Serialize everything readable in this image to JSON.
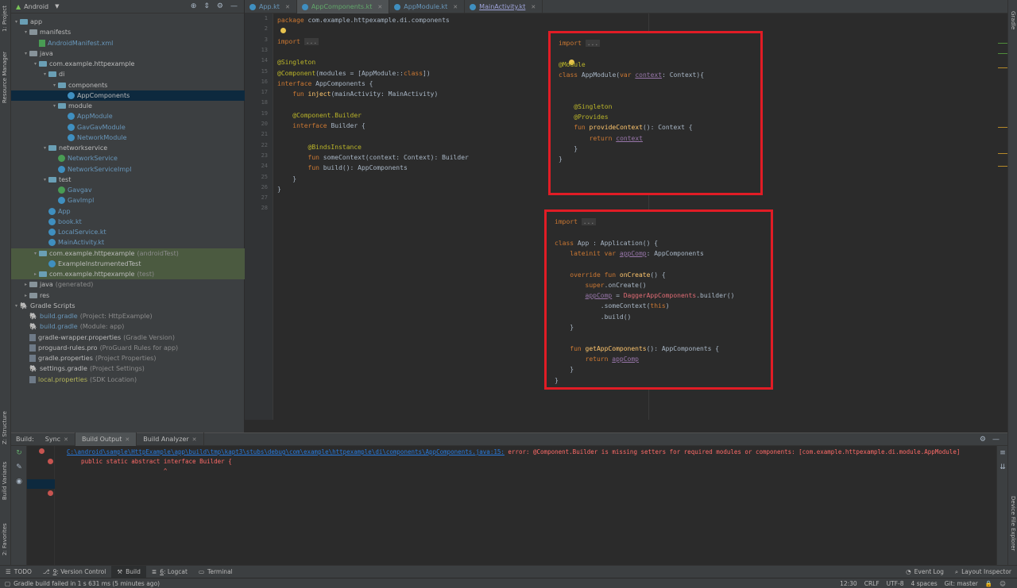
{
  "left_strip": {
    "tabs": [
      "1: Project",
      "Resource Manager",
      "Z: Structure",
      "Build Variants",
      "2: Favorites"
    ]
  },
  "right_strip": {
    "tabs": [
      "Gradle",
      "Device File Explorer"
    ]
  },
  "project": {
    "view_label": "Android",
    "rows": [
      {
        "label": "app",
        "suffix": "",
        "color": "white",
        "icon": "folder",
        "depth": 0,
        "arrow": "▾"
      },
      {
        "label": "manifests",
        "suffix": "",
        "color": "white",
        "icon": "folder",
        "depth": 1,
        "arrow": "▾"
      },
      {
        "label": "AndroidManifest.xml",
        "suffix": "",
        "color": "blue",
        "icon": "xml",
        "depth": 2,
        "arrow": ""
      },
      {
        "label": "java",
        "suffix": "",
        "color": "white",
        "icon": "folder",
        "depth": 1,
        "arrow": "▾"
      },
      {
        "label": "com.example.httpexample",
        "suffix": "",
        "color": "white",
        "icon": "pkg",
        "depth": 2,
        "arrow": "▾"
      },
      {
        "label": "di",
        "suffix": "",
        "color": "white",
        "icon": "pkg",
        "depth": 3,
        "arrow": "▾"
      },
      {
        "label": "components",
        "suffix": "",
        "color": "white",
        "icon": "pkg",
        "depth": 4,
        "arrow": "▾"
      },
      {
        "label": "AppComponents",
        "suffix": "",
        "color": "sel",
        "icon": "kt",
        "depth": 5,
        "arrow": ""
      },
      {
        "label": "module",
        "suffix": "",
        "color": "white",
        "icon": "pkg",
        "depth": 4,
        "arrow": "▾"
      },
      {
        "label": "AppModule",
        "suffix": "",
        "color": "blue",
        "icon": "kt",
        "depth": 5,
        "arrow": ""
      },
      {
        "label": "GavGavModule",
        "suffix": "",
        "color": "blue",
        "icon": "kt",
        "depth": 5,
        "arrow": ""
      },
      {
        "label": "NetworkModule",
        "suffix": "",
        "color": "blue",
        "icon": "kt",
        "depth": 5,
        "arrow": ""
      },
      {
        "label": "networkservice",
        "suffix": "",
        "color": "white",
        "icon": "pkg",
        "depth": 3,
        "arrow": "▾"
      },
      {
        "label": "NetworkService",
        "suffix": "",
        "color": "blue",
        "icon": "ktg",
        "depth": 4,
        "arrow": ""
      },
      {
        "label": "NetworkServiceImpl",
        "suffix": "",
        "color": "blue",
        "icon": "kt",
        "depth": 4,
        "arrow": ""
      },
      {
        "label": "test",
        "suffix": "",
        "color": "white",
        "icon": "pkg",
        "depth": 3,
        "arrow": "▾"
      },
      {
        "label": "Gavgav",
        "suffix": "",
        "color": "blue",
        "icon": "ktg",
        "depth": 4,
        "arrow": ""
      },
      {
        "label": "GavImpl",
        "suffix": "",
        "color": "blue",
        "icon": "kt",
        "depth": 4,
        "arrow": ""
      },
      {
        "label": "App",
        "suffix": "",
        "color": "blue",
        "icon": "kt",
        "depth": 3,
        "arrow": ""
      },
      {
        "label": "book.kt",
        "suffix": "",
        "color": "blue",
        "icon": "kt",
        "depth": 3,
        "arrow": ""
      },
      {
        "label": "LocalService.kt",
        "suffix": "",
        "color": "blue",
        "icon": "kt",
        "depth": 3,
        "arrow": ""
      },
      {
        "label": "MainActivity.kt",
        "suffix": "",
        "color": "blue",
        "icon": "kt",
        "depth": 3,
        "arrow": ""
      },
      {
        "label": "com.example.httpexample",
        "suffix": "(androidTest)",
        "color": "white",
        "icon": "pkg",
        "depth": 2,
        "arrow": "▾",
        "hl": true
      },
      {
        "label": "ExampleInstrumentedTest",
        "suffix": "",
        "color": "white",
        "icon": "kt",
        "depth": 3,
        "arrow": "",
        "hl": true
      },
      {
        "label": "com.example.httpexample",
        "suffix": "(test)",
        "color": "white",
        "icon": "pkg",
        "depth": 2,
        "arrow": "▸",
        "hl": true
      },
      {
        "label": "java",
        "suffix": "(generated)",
        "color": "white",
        "icon": "folder",
        "depth": 1,
        "arrow": "▸"
      },
      {
        "label": "res",
        "suffix": "",
        "color": "white",
        "icon": "folder",
        "depth": 1,
        "arrow": "▸"
      },
      {
        "label": "Gradle Scripts",
        "suffix": "",
        "color": "white",
        "icon": "gradle",
        "depth": 0,
        "arrow": "▾"
      },
      {
        "label": "build.gradle",
        "suffix": "(Project: HttpExample)",
        "color": "blue",
        "icon": "gradle",
        "depth": 1,
        "arrow": ""
      },
      {
        "label": "build.gradle",
        "suffix": "(Module: app)",
        "color": "blue",
        "icon": "gradle",
        "depth": 1,
        "arrow": ""
      },
      {
        "label": "gradle-wrapper.properties",
        "suffix": "(Gradle Version)",
        "color": "white",
        "icon": "file",
        "depth": 1,
        "arrow": ""
      },
      {
        "label": "proguard-rules.pro",
        "suffix": "(ProGuard Rules for app)",
        "color": "white",
        "icon": "file",
        "depth": 1,
        "arrow": ""
      },
      {
        "label": "gradle.properties",
        "suffix": "(Project Properties)",
        "color": "white",
        "icon": "file",
        "depth": 1,
        "arrow": ""
      },
      {
        "label": "settings.gradle",
        "suffix": "(Project Settings)",
        "color": "white",
        "icon": "gradle",
        "depth": 1,
        "arrow": ""
      },
      {
        "label": "local.properties",
        "suffix": "(SDK Location)",
        "color": "olive",
        "icon": "file",
        "depth": 1,
        "arrow": ""
      }
    ]
  },
  "tabs": [
    {
      "label": "App.kt",
      "active": false
    },
    {
      "label": "AppComponents.kt",
      "active": true
    },
    {
      "label": "AppModule.kt",
      "active": false
    },
    {
      "label": "MainActivity.kt",
      "active": false
    }
  ],
  "editor": {
    "line_numbers": [
      "1",
      "2",
      "3",
      "13",
      "14",
      "15",
      "16",
      "17",
      "18",
      "19",
      "20",
      "21",
      "22",
      "23",
      "24",
      "25",
      "26",
      "27",
      "28"
    ],
    "lines": [
      [
        {
          "t": "package ",
          "c": "kw"
        },
        {
          "t": "com.example.httpexample.di.components",
          "c": ""
        }
      ],
      [],
      [
        {
          "t": "import ",
          "c": "kw"
        },
        {
          "t": "...",
          "c": "fold"
        }
      ],
      [],
      [
        {
          "t": "@Singleton",
          "c": "an"
        }
      ],
      [
        {
          "t": "@Component",
          "c": "an"
        },
        {
          "t": "(modules = [AppModule::",
          "c": ""
        },
        {
          "t": "class",
          "c": "kw"
        },
        {
          "t": "])",
          "c": ""
        }
      ],
      [
        {
          "t": "interface ",
          "c": "kw"
        },
        {
          "t": "AppComponents {",
          "c": ""
        }
      ],
      [
        {
          "t": "    fun ",
          "c": "kw"
        },
        {
          "t": "inject",
          "c": "fn"
        },
        {
          "t": "(mainActivity: MainActivity)",
          "c": ""
        }
      ],
      [],
      [
        {
          "t": "    @Component.Builder",
          "c": "an"
        }
      ],
      [
        {
          "t": "    interface ",
          "c": "kw"
        },
        {
          "t": "Builder {",
          "c": ""
        }
      ],
      [],
      [
        {
          "t": "        @BindsInstance",
          "c": "an"
        }
      ],
      [
        {
          "t": "        fun ",
          "c": "kw"
        },
        {
          "t": "someContext(context: Context): Builder",
          "c": ""
        }
      ],
      [
        {
          "t": "        fun ",
          "c": "kw"
        },
        {
          "t": "build(): AppComponents",
          "c": ""
        }
      ],
      [
        {
          "t": "    }",
          "c": ""
        }
      ],
      [
        {
          "t": "}",
          "c": ""
        }
      ],
      [],
      []
    ]
  },
  "overlay_module": {
    "lines": [
      [
        {
          "t": "import ",
          "c": "kw"
        },
        {
          "t": "...",
          "c": "fold"
        }
      ],
      [],
      [
        {
          "t": "@Module",
          "c": "an"
        }
      ],
      [
        {
          "t": "class ",
          "c": "kw"
        },
        {
          "t": "AppModule(",
          "c": ""
        },
        {
          "t": "var ",
          "c": "kw"
        },
        {
          "t": "context",
          "c": "pp"
        },
        {
          "t": ": Context){",
          "c": ""
        }
      ],
      [],
      [],
      [
        {
          "t": "    @Singleton",
          "c": "an"
        }
      ],
      [
        {
          "t": "    @Provides",
          "c": "an"
        }
      ],
      [
        {
          "t": "    fun ",
          "c": "kw"
        },
        {
          "t": "provideContext",
          "c": "fn"
        },
        {
          "t": "(): Context {",
          "c": ""
        }
      ],
      [
        {
          "t": "        return ",
          "c": "kw"
        },
        {
          "t": "context",
          "c": "pp"
        }
      ],
      [
        {
          "t": "    }",
          "c": ""
        }
      ],
      [
        {
          "t": "}",
          "c": ""
        }
      ]
    ]
  },
  "overlay_app": {
    "lines": [
      [
        {
          "t": "import ",
          "c": "kw"
        },
        {
          "t": "...",
          "c": "fold"
        }
      ],
      [],
      [
        {
          "t": "class ",
          "c": "kw"
        },
        {
          "t": "App : Application() {",
          "c": ""
        }
      ],
      [
        {
          "t": "    lateinit var ",
          "c": "kw"
        },
        {
          "t": "appComp",
          "c": "pp"
        },
        {
          "t": ": AppComponents",
          "c": ""
        }
      ],
      [],
      [
        {
          "t": "    override fun ",
          "c": "kw"
        },
        {
          "t": "onCreate",
          "c": "fn"
        },
        {
          "t": "() {",
          "c": ""
        }
      ],
      [
        {
          "t": "        super",
          "c": "kw"
        },
        {
          "t": ".onCreate()",
          "c": ""
        }
      ],
      [
        {
          "t": "        ",
          "c": ""
        },
        {
          "t": "appComp",
          "c": "pp"
        },
        {
          "t": " = ",
          "c": ""
        },
        {
          "t": "DaggerAppComponents",
          "c": "red"
        },
        {
          "t": ".builder()",
          "c": ""
        }
      ],
      [
        {
          "t": "            .someContext(",
          "c": ""
        },
        {
          "t": "this",
          "c": "kw"
        },
        {
          "t": ")",
          "c": ""
        }
      ],
      [
        {
          "t": "            .build()",
          "c": ""
        }
      ],
      [
        {
          "t": "    }",
          "c": ""
        }
      ],
      [],
      [
        {
          "t": "    fun ",
          "c": "kw"
        },
        {
          "t": "getAppComponents",
          "c": "fn"
        },
        {
          "t": "(): AppComponents {",
          "c": ""
        }
      ],
      [
        {
          "t": "        return ",
          "c": "kw"
        },
        {
          "t": "appComp",
          "c": "pp"
        }
      ],
      [
        {
          "t": "    }",
          "c": ""
        }
      ],
      [
        {
          "t": "}",
          "c": ""
        }
      ]
    ]
  },
  "build": {
    "label": "Build:",
    "tabs": [
      {
        "label": "Sync",
        "active": false
      },
      {
        "label": "Build Output",
        "active": true
      },
      {
        "label": "Build Analyzer",
        "active": false
      }
    ],
    "error_path": "C:\\android\\sample\\HttpExample\\app\\build\\tmp\\kapt3\\stubs\\debug\\com\\example\\httpexample\\di\\components\\AppComponents.java:15:",
    "error_message": " error: @Component.Builder is missing setters for required modules or components: [com.example.httpexample.di.module.AppModule]",
    "error_line2": "    public static abstract interface Builder {",
    "error_line3": "                           ^"
  },
  "bottom_tools": [
    {
      "label": "TODO",
      "key": "",
      "active": false
    },
    {
      "label": ": Version Control",
      "key": "9",
      "active": false
    },
    {
      "label": "Build",
      "key": "",
      "active": true
    },
    {
      "label": ": Logcat",
      "key": "6",
      "active": false
    },
    {
      "label": "Terminal",
      "key": "",
      "active": false
    }
  ],
  "bottom_right": [
    "Event Log",
    "Layout Inspector"
  ],
  "status": {
    "message": "Gradle build failed in 1 s 631 ms (5 minutes ago)",
    "position": "12:30",
    "line_sep": "CRLF",
    "encoding": "UTF-8",
    "indent": "4 spaces",
    "git": "Git: master"
  }
}
